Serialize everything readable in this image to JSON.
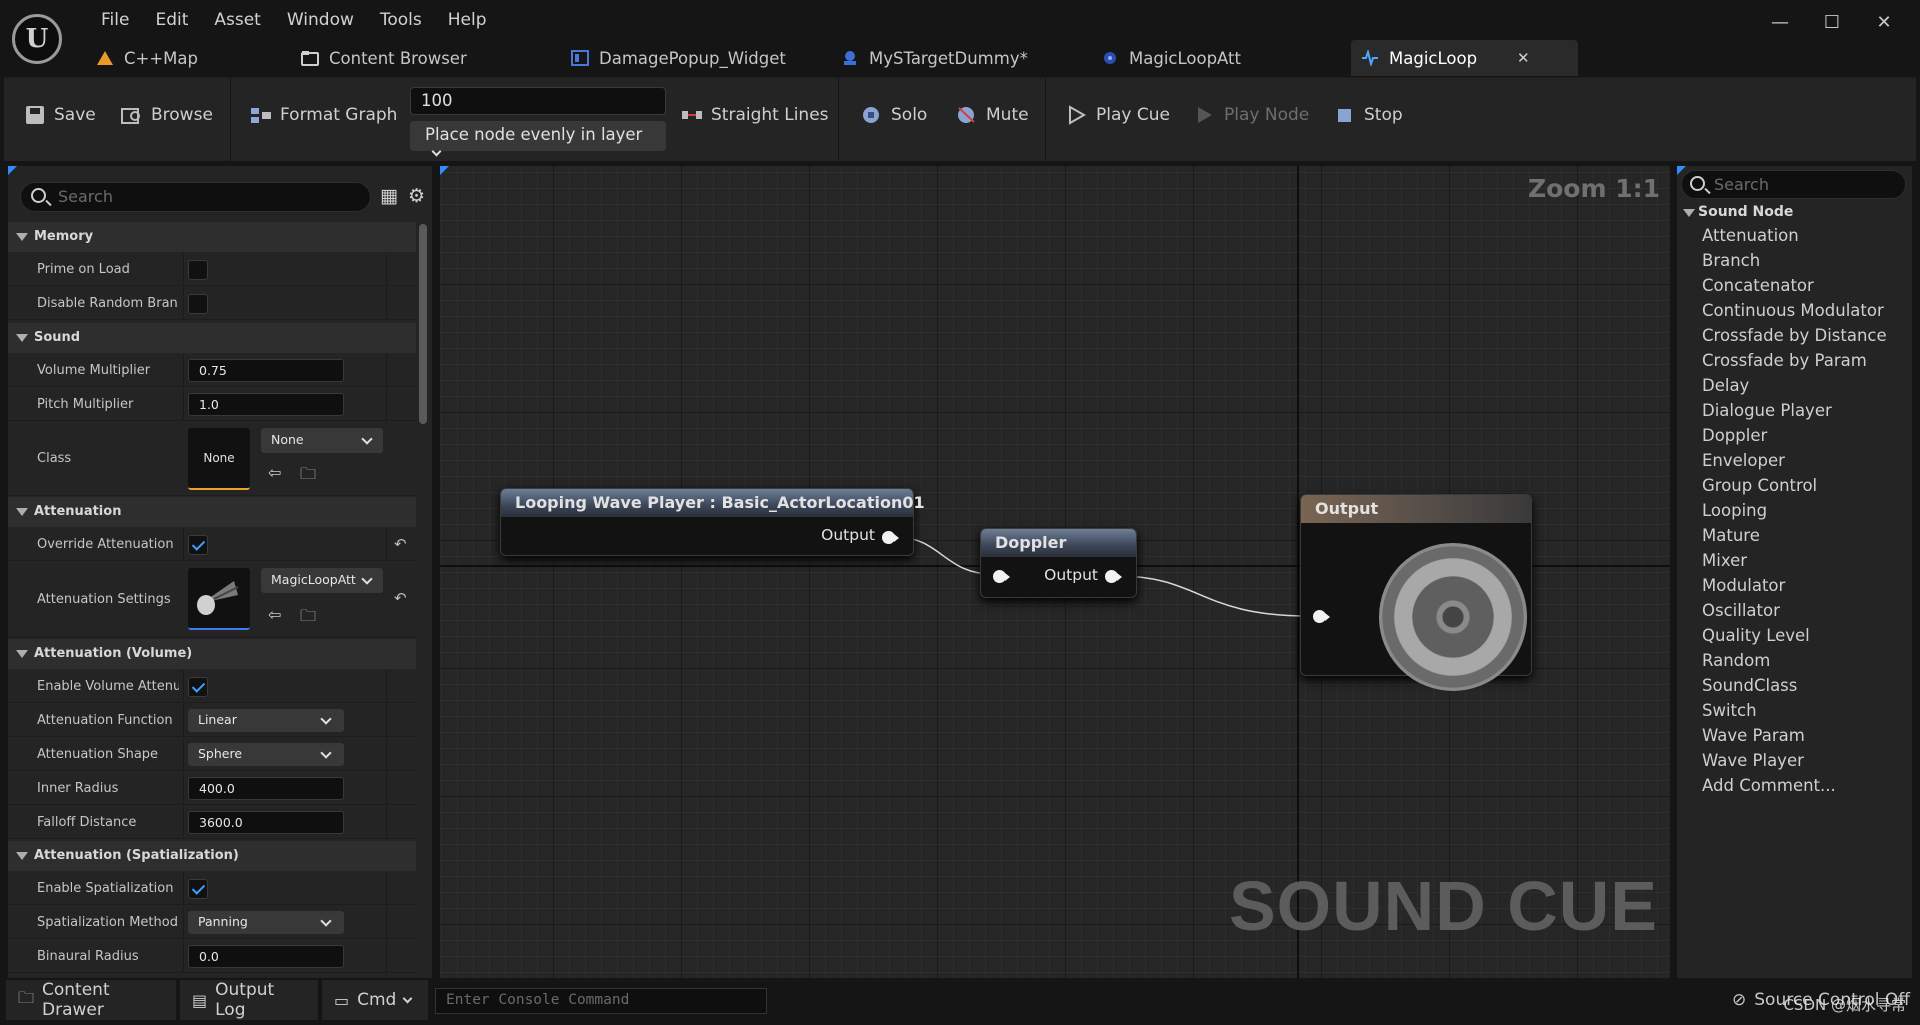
{
  "menu": [
    "File",
    "Edit",
    "Asset",
    "Window",
    "Tools",
    "Help"
  ],
  "window_controls": [
    "—",
    "☐",
    "✕"
  ],
  "tabs": [
    {
      "label": "C++Map",
      "icon": "map-icon"
    },
    {
      "label": "Content Browser",
      "icon": "folder-icon"
    },
    {
      "label": "DamagePopup_Widget",
      "icon": "widget-icon"
    },
    {
      "label": "MySTargetDummy*",
      "icon": "blueprint-icon"
    },
    {
      "label": "MagicLoopAtt",
      "icon": "attenuation-icon"
    },
    {
      "label": "MagicLoop",
      "icon": "soundcue-icon",
      "close": "✕"
    }
  ],
  "toolbar": {
    "save": "Save",
    "browse": "Browse",
    "format_graph": "Format Graph",
    "spacing_value": "100",
    "layout_mode": "Place node evenly in layer",
    "straight_lines": "Straight Lines",
    "solo": "Solo",
    "mute": "Mute",
    "play_cue": "Play Cue",
    "play_node": "Play Node",
    "stop": "Stop"
  },
  "details": {
    "search_placeholder": "Search",
    "memory": {
      "title": "Memory",
      "prime_on_load": "Prime on Load",
      "prime_on_load_checked": false,
      "disable_random_branch": "Disable Random Bran...",
      "disable_random_branch_checked": false
    },
    "sound": {
      "title": "Sound",
      "volume_label": "Volume Multiplier",
      "volume_value": "0.75",
      "pitch_label": "Pitch Multiplier",
      "pitch_value": "1.0",
      "class_label": "Class",
      "class_thumb": "None",
      "class_value": "None"
    },
    "attenuation": {
      "title": "Attenuation",
      "override_label": "Override Attenuation",
      "override_checked": true,
      "settings_label": "Attenuation Settings",
      "settings_value": "MagicLoopAtt"
    },
    "attenuation_volume": {
      "title": "Attenuation (Volume)",
      "enable_label": "Enable Volume Attenu...",
      "enable_checked": true,
      "function_label": "Attenuation Function",
      "function_value": "Linear",
      "shape_label": "Attenuation Shape",
      "shape_value": "Sphere",
      "inner_label": "Inner Radius",
      "inner_value": "400.0",
      "falloff_label": "Falloff Distance",
      "falloff_value": "3600.0"
    },
    "attenuation_spatial": {
      "title": "Attenuation (Spatialization)",
      "enable_label": "Enable Spatialization",
      "enable_checked": true,
      "method_label": "Spatialization Method",
      "method_value": "Panning",
      "binaural_label": "Binaural Radius",
      "binaural_value": "0.0"
    }
  },
  "graph": {
    "zoom": "Zoom 1:1",
    "watermark": "SOUND CUE",
    "nodes": {
      "wave_player": {
        "title": "Looping Wave Player : Basic_ActorLocation01",
        "output": "Output"
      },
      "doppler": {
        "title": "Doppler",
        "output": "Output"
      },
      "output": {
        "title": "Output"
      }
    }
  },
  "palette": {
    "search_placeholder": "Search",
    "category": "Sound Node",
    "items": [
      "Attenuation",
      "Branch",
      "Concatenator",
      "Continuous Modulator",
      "Crossfade by Distance",
      "Crossfade by Param",
      "Delay",
      "Dialogue Player",
      "Doppler",
      "Enveloper",
      "Group Control",
      "Looping",
      "Mature",
      "Mixer",
      "Modulator",
      "Oscillator",
      "Quality Level",
      "Random",
      "SoundClass",
      "Switch",
      "Wave Param",
      "Wave Player",
      "Add Comment..."
    ]
  },
  "statusbar": {
    "content_drawer": "Content Drawer",
    "output_log": "Output Log",
    "cmd": "Cmd",
    "console_placeholder": "Enter Console Command",
    "source_control": "Source Control Off",
    "watermark": "CSDN @烟水寻常"
  },
  "colors": {
    "accent": "#2f8dff",
    "check": "#3ea0ff",
    "class_underline": "#e8a22a",
    "attenuation_underline": "#3d7df0"
  }
}
